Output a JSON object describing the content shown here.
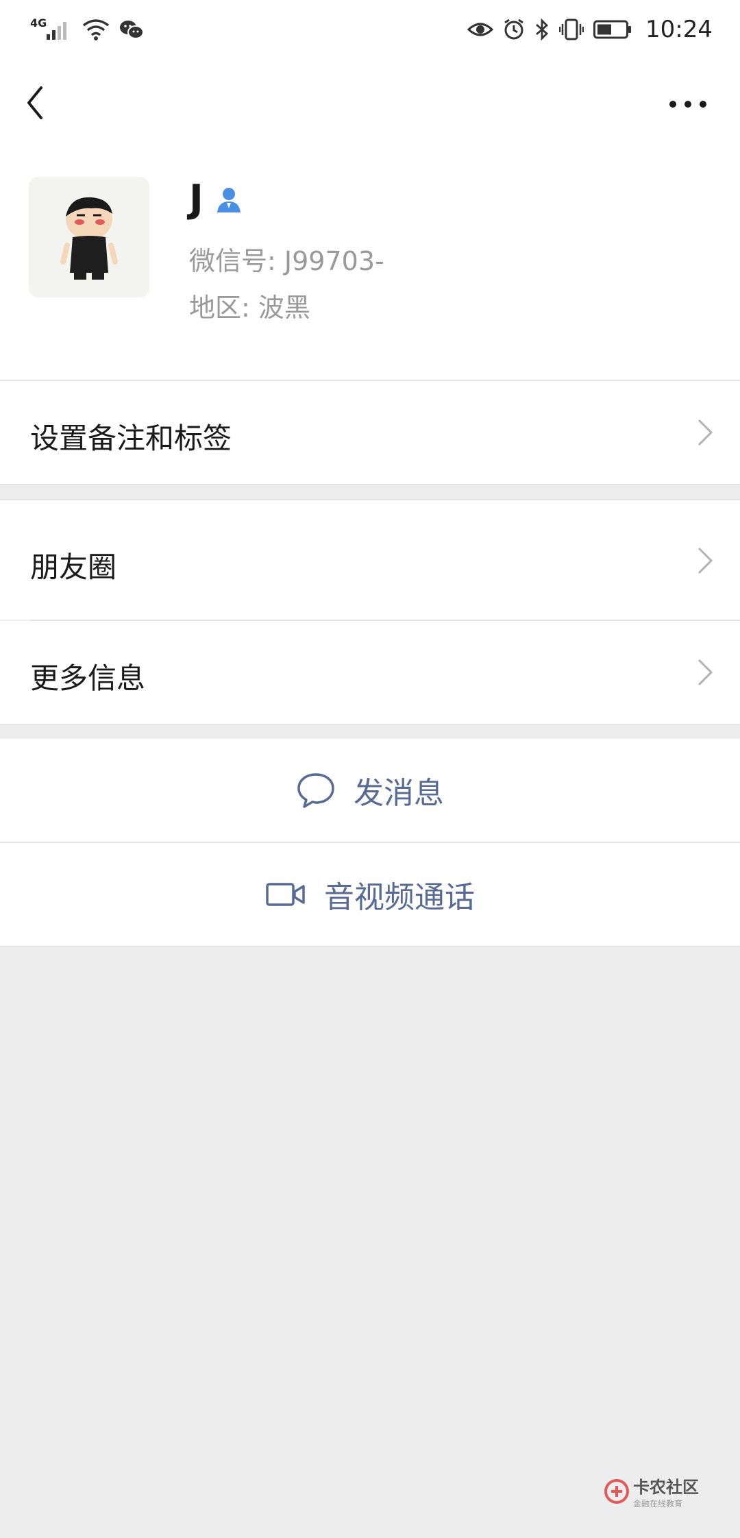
{
  "status_bar": {
    "network": "4G",
    "time": "10:24"
  },
  "nav": {
    "back_icon": "chevron-left-icon",
    "more_icon": "more-dots-icon"
  },
  "profile": {
    "name": "J",
    "wechat_id_label": "微信号:",
    "wechat_id": "J99703-",
    "region_label": "地区:",
    "region": "波黑"
  },
  "menu": {
    "remarks_tags": "设置备注和标签",
    "moments": "朋友圈",
    "more_info": "更多信息"
  },
  "actions": {
    "send_message": "发消息",
    "video_call": "音视频通话"
  },
  "watermark": {
    "title": "卡农社区",
    "subtitle": "金融在线教育"
  },
  "colors": {
    "link_blue": "#576b95",
    "contact_badge": "#4a90e2",
    "page_bg": "#ededed"
  }
}
